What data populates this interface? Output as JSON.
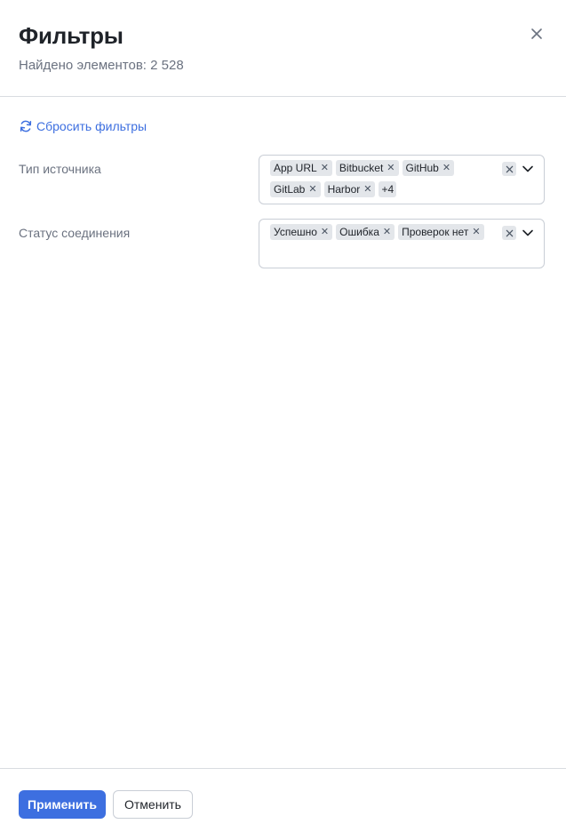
{
  "header": {
    "title": "Фильтры",
    "subtitle": "Найдено элементов: 2 528"
  },
  "reset": {
    "label": "Сбросить фильтры"
  },
  "filters": {
    "source_type": {
      "label": "Тип источника",
      "chips": [
        "App URL",
        "Bitbucket",
        "GitHub",
        "GitLab",
        "Harbor"
      ],
      "more": "+4"
    },
    "connection_status": {
      "label": "Статус соединения",
      "chips": [
        "Успешно",
        "Ошибка",
        "Проверок нет"
      ]
    }
  },
  "footer": {
    "apply_label": "Применить",
    "cancel_label": "Отменить"
  },
  "colors": {
    "accent": "#3d6fe0",
    "chip_bg": "#e3e6ea",
    "border": "#c9ced6"
  },
  "icons": {
    "close": "close-icon",
    "reset": "refresh-icon",
    "chip_remove": "x-icon",
    "dropdown": "chevron-down-icon"
  }
}
